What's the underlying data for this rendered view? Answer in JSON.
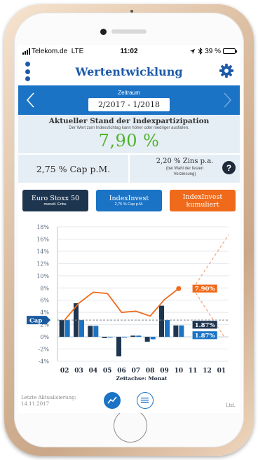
{
  "status": {
    "carrier": "Telekom.de",
    "network": "LTE",
    "time": "11:02",
    "battery_text": "39 %",
    "battery_level": 0.39
  },
  "header": {
    "title": "Wertentwicklung"
  },
  "period": {
    "label": "Zeitraum",
    "value": "2/2017 - 1/2018"
  },
  "indexpart": {
    "title": "Aktueller Stand der Indexpartizipation",
    "subtitle": "Der Wert zum Indexstichtag kann höher oder niedriger ausfallen.",
    "value": "7,90 %"
  },
  "cap": {
    "text": "2,75 % Cap p.M."
  },
  "zins": {
    "main": "2,20 % Zins p.a.",
    "note_line1": "(bei Wahl der festen",
    "note_line2": "Verzinsung)"
  },
  "help": {
    "label": "?"
  },
  "tabs": [
    {
      "title": "Euro Stoxx 50",
      "subtitle": "monatl. Entw."
    },
    {
      "title": "IndexInvest",
      "subtitle": "2,75 % Cap p.M."
    },
    {
      "title": "IndexInvest",
      "subtitle": "kumuliert"
    }
  ],
  "chart_data": {
    "type": "bar",
    "categories": [
      "02",
      "03",
      "04",
      "05",
      "06",
      "07",
      "08",
      "09",
      "10",
      "11",
      "12",
      "01"
    ],
    "xlabel": "Zeitachse: Monat",
    "ylabel": "",
    "ylim": [
      -4,
      18
    ],
    "yticks": [
      "18%",
      "16%",
      "14%",
      "12%",
      "10%",
      "8%",
      "6%",
      "4%",
      "2%",
      "0%",
      "-2%",
      "-4%"
    ],
    "ytick_values": [
      18,
      16,
      14,
      12,
      10,
      8,
      6,
      4,
      2,
      0,
      -2,
      -4
    ],
    "cap_line": {
      "label": "Cap",
      "value": 2.75
    },
    "grid": true,
    "series": [
      {
        "values": [
          2.75,
          5.5,
          1.8,
          -0.2,
          -3.2,
          0.2,
          -0.8,
          5.1,
          1.87,
          null,
          null,
          null
        ],
        "color": "#1e3550"
      },
      {
        "values": [
          2.75,
          2.75,
          1.8,
          0.0,
          -0.1,
          0.2,
          -0.4,
          2.75,
          1.87,
          null,
          null,
          null
        ],
        "color": "#1a73c5"
      },
      {
        "type": "line",
        "values": [
          2.75,
          5.5,
          7.3,
          7.1,
          4.0,
          4.2,
          3.4,
          6.1,
          7.9,
          null,
          null,
          null
        ],
        "color": "#f06a1b"
      }
    ],
    "projection_upper": [
      [
        9,
        7.9
      ],
      [
        12,
        16.7
      ]
    ],
    "projection_lower": [
      [
        9,
        7.9
      ],
      [
        12,
        0.0
      ]
    ],
    "labels": [
      {
        "text": "7.90%",
        "series": "kumuliert",
        "value": 7.9
      },
      {
        "text": "1.87%",
        "series": "euro",
        "value": 1.87
      },
      {
        "text": "1.87%",
        "series": "cap",
        "value": 1.87
      }
    ]
  },
  "footer": {
    "updated_label": "Letzte Aktualisierung:",
    "updated_date": "14.11.2017",
    "ltd": "Ltd."
  }
}
